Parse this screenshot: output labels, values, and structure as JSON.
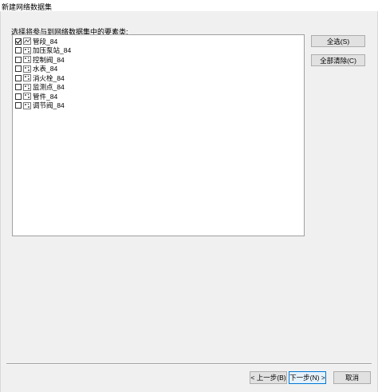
{
  "window": {
    "title": "新建网络数据集"
  },
  "prompt": "选择将参与到网络数据集中的要素类:",
  "items": [
    {
      "label": "管段_84",
      "checked": true,
      "icon": "line-feature-icon"
    },
    {
      "label": "加压泵站_84",
      "checked": false,
      "icon": "point-feature-icon"
    },
    {
      "label": "控制阀_84",
      "checked": false,
      "icon": "point-feature-icon"
    },
    {
      "label": "水表_84",
      "checked": false,
      "icon": "point-feature-icon"
    },
    {
      "label": "消火栓_84",
      "checked": false,
      "icon": "point-feature-icon"
    },
    {
      "label": "监测点_84",
      "checked": false,
      "icon": "point-feature-icon"
    },
    {
      "label": "管件_84",
      "checked": false,
      "icon": "point-feature-icon"
    },
    {
      "label": "调节阀_84",
      "checked": false,
      "icon": "point-feature-icon"
    }
  ],
  "buttons": {
    "select_all": "全选(S)",
    "clear_all": "全部清除(C)",
    "back": "< 上一步(B)",
    "next": "下一步(N) >",
    "cancel": "取消"
  }
}
